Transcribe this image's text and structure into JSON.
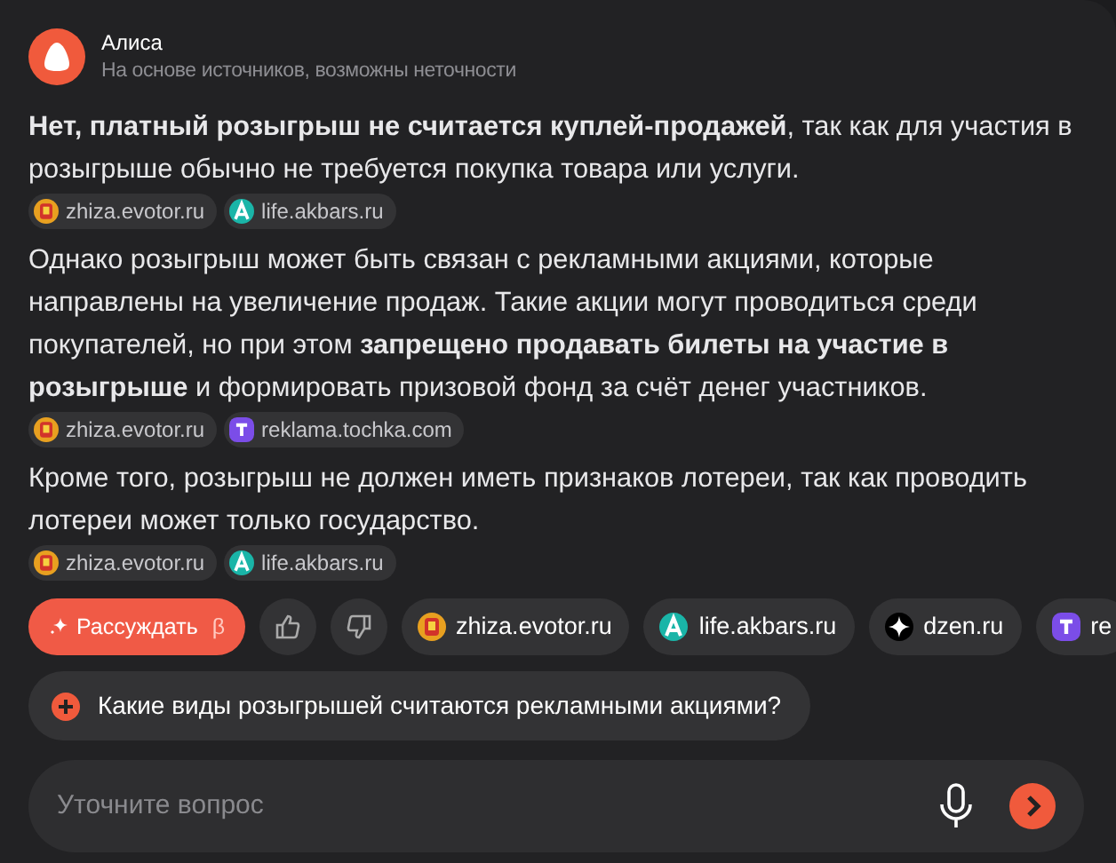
{
  "header": {
    "title": "Алиса",
    "subtitle": "На основе источников, возможны неточности"
  },
  "paragraphs": [
    {
      "text": "**Нет, платный розыгрыш не считается куплей-продажей**, так как для участия в розыгрыше обычно не требуется покупка товара или услуги.",
      "sources": [
        {
          "kind": "evotor",
          "label": "zhiza.evotor.ru"
        },
        {
          "kind": "akbars",
          "label": "life.akbars.ru"
        }
      ]
    },
    {
      "text": "Однако розыгрыш может быть связан с рекламными акциями, которые направлены на увеличение продаж. Такие акции могут проводиться среди покупателей, но при этом **запрещено продавать билеты на участие в розыгрыше** и формировать призовой фонд за счёт денег участников.",
      "sources": [
        {
          "kind": "evotor",
          "label": "zhiza.evotor.ru"
        },
        {
          "kind": "tochka",
          "label": "reklama.tochka.com"
        }
      ]
    },
    {
      "text": "Кроме того, розыгрыш не должен иметь признаков лотереи, так как проводить лотереи может только государство.",
      "sources": [
        {
          "kind": "evotor",
          "label": "zhiza.evotor.ru"
        },
        {
          "kind": "akbars",
          "label": "life.akbars.ru"
        }
      ]
    }
  ],
  "actions": {
    "reason_button": "Рассуждать",
    "beta_mark": "β"
  },
  "source_chips": [
    {
      "kind": "evotor",
      "label": "zhiza.evotor.ru"
    },
    {
      "kind": "akbars",
      "label": "life.akbars.ru"
    },
    {
      "kind": "dzen",
      "label": "dzen.ru"
    },
    {
      "kind": "tochka",
      "label": "re"
    }
  ],
  "suggestion": "Какие виды розыгрышей считаются рекламными акциями?",
  "input": {
    "placeholder": "Уточните вопрос"
  }
}
